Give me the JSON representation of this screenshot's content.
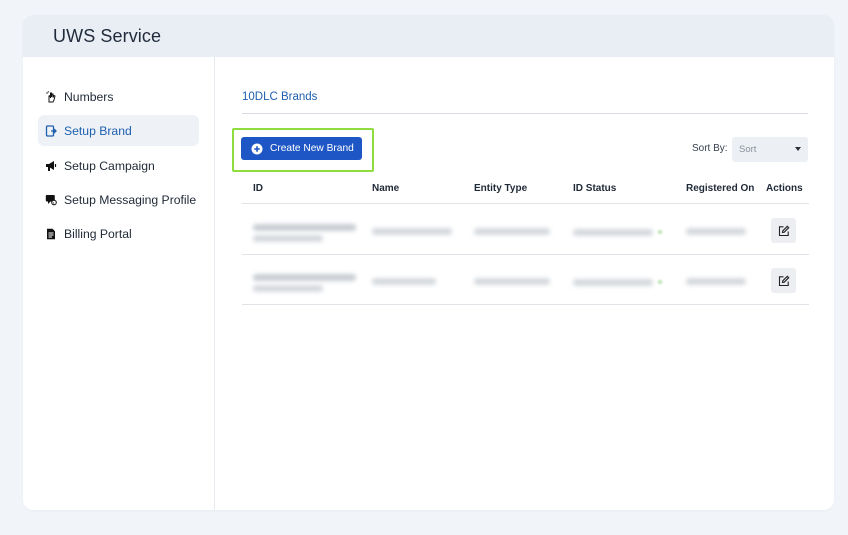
{
  "app": {
    "title": "UWS Service"
  },
  "sidebar": {
    "items": [
      {
        "label": "Numbers",
        "icon": "hand-icon",
        "active": false
      },
      {
        "label": "Setup Brand",
        "icon": "brand-icon",
        "active": true
      },
      {
        "label": "Setup Campaign",
        "icon": "megaphone-icon",
        "active": false
      },
      {
        "label": "Setup Messaging Profile",
        "icon": "message-profile-icon",
        "active": false
      },
      {
        "label": "Billing Portal",
        "icon": "document-icon",
        "active": false
      }
    ]
  },
  "main": {
    "tab": "10DLC Brands",
    "create_button": {
      "label": "Create New Brand",
      "icon": "plus-circle-icon"
    },
    "sort": {
      "label": "Sort By:",
      "placeholder": "Sort"
    },
    "table": {
      "columns": [
        "ID",
        "Name",
        "Entity Type",
        "ID Status",
        "Registered On",
        "Actions"
      ],
      "rows": [
        {
          "id": "",
          "name": "",
          "entity_type": "",
          "id_status": "",
          "registered_on": "",
          "action": "edit-icon"
        },
        {
          "id": "",
          "name": "",
          "entity_type": "",
          "id_status": "",
          "registered_on": "",
          "action": "edit-icon"
        }
      ],
      "note": ""
    }
  },
  "colors": {
    "accent": "#1e57c5",
    "link": "#1e5fae",
    "highlight": "#8fdc3e",
    "header_bg": "#e9edf4",
    "page_bg": "#f1f4f8"
  }
}
